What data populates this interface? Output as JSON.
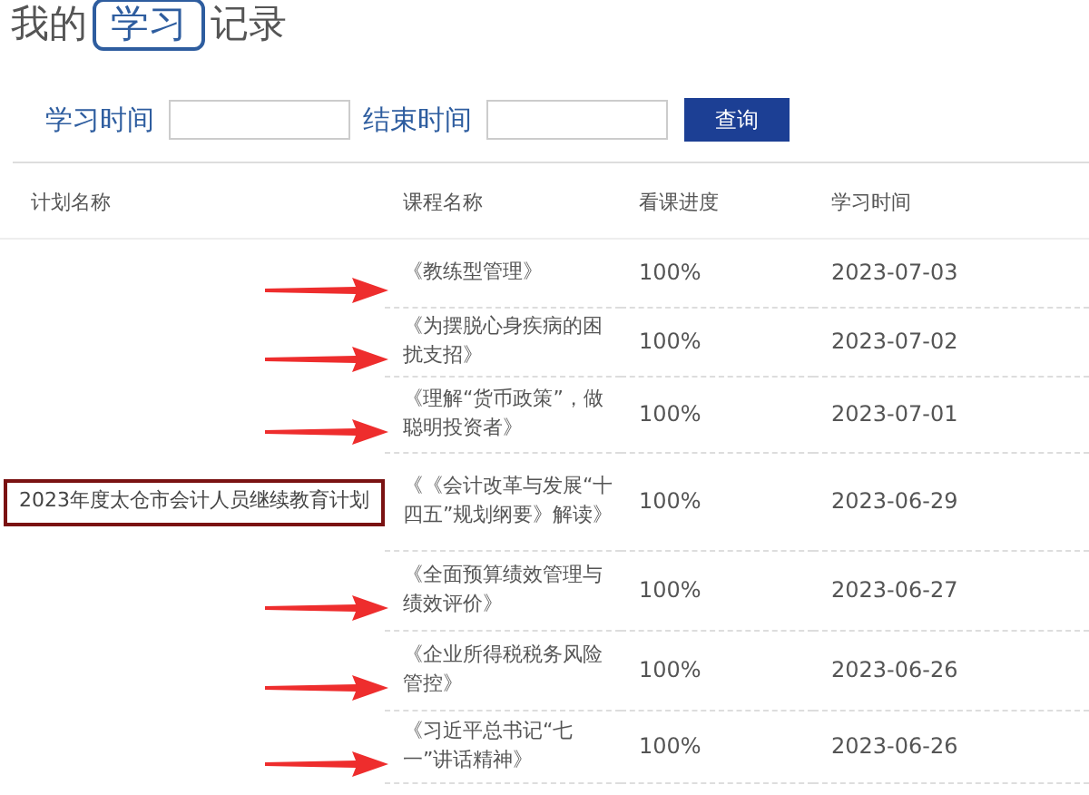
{
  "title": {
    "before": "我的",
    "boxed": "学习",
    "after": "记录"
  },
  "search": {
    "start_label": "学习时间",
    "end_label": "结束时间",
    "button": "查询"
  },
  "table": {
    "columns": [
      "计划名称",
      "课程名称",
      "看课进度",
      "学习时间"
    ],
    "plan": {
      "name": "2023年度太仓市会计人员继续教育计划",
      "highlighted": true
    },
    "rows": [
      {
        "course": "《教练型管理》",
        "progress": "100%",
        "date": "2023-07-03",
        "arrow": true
      },
      {
        "course": "《为摆脱心身疾病的困扰支招》",
        "progress": "100%",
        "date": "2023-07-02",
        "arrow": true
      },
      {
        "course": "《理解“货币政策”，做聪明投资者》",
        "progress": "100%",
        "date": "2023-07-01",
        "arrow": true
      },
      {
        "course": "《《会计改革与发展“十四五”规划纲要》解读》",
        "progress": "100%",
        "date": "2023-06-29",
        "arrow": false
      },
      {
        "course": "《全面预算绩效管理与绩效评价》",
        "progress": "100%",
        "date": "2023-06-27",
        "arrow": true
      },
      {
        "course": "《企业所得税税务风险管控》",
        "progress": "100%",
        "date": "2023-06-26",
        "arrow": true
      },
      {
        "course": "《习近平总书记“七一”讲话精神》",
        "progress": "100%",
        "date": "2023-06-26",
        "arrow": true
      }
    ]
  }
}
